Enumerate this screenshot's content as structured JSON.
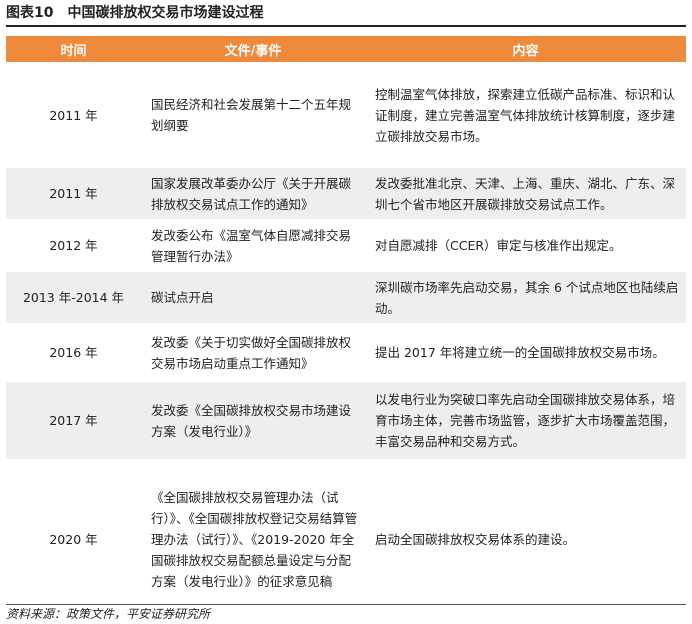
{
  "figure": {
    "number": "图表10",
    "title": "中国碳排放权交易市场建设过程"
  },
  "table": {
    "headers": [
      "时间",
      "文件/事件",
      "内容"
    ],
    "rows": [
      {
        "time": "2011 年",
        "doc": "国民经济和社会发展第十二个五年规划纲要",
        "content": "控制温室气体排放，探索建立低碳产品标准、标识和认证制度，建立完善温室气体排放统计核算制度，逐步建立碳排放交易市场。"
      },
      {
        "time": "2011 年",
        "doc": "国家发展改革委办公厅《关于开展碳排放权交易试点工作的通知》",
        "content": "发改委批准北京、天津、上海、重庆、湖北、广东、深圳七个省市地区开展碳排放交易试点工作。"
      },
      {
        "time": "2012 年",
        "doc": "发改委公布《温室气体自愿减排交易管理暂行办法》",
        "content": "对自愿减排（CCER）审定与核准作出规定。"
      },
      {
        "time": "2013 年-2014 年",
        "doc": "碳试点开启",
        "content": "深圳碳市场率先启动交易，其余 6 个试点地区也陆续启动。"
      },
      {
        "time": "2016 年",
        "doc": "发改委《关于切实做好全国碳排放权交易市场启动重点工作通知》",
        "content": "提出 2017 年将建立统一的全国碳排放权交易市场。"
      },
      {
        "time": "2017 年",
        "doc": "发改委《全国碳排放权交易市场建设方案（发电行业）》",
        "content": "以发电行业为突破口率先启动全国碳排放交易体系，培育市场主体，完善市场监管，逐步扩大市场覆盖范围，丰富交易品种和交易方式。"
      },
      {
        "time": "2020 年",
        "doc": "《全国碳排放权交易管理办法（试行）》、《全国碳排放权登记交易结算管理办法（试行）》、《2019-2020 年全国碳排放权交易配额总量设定与分配方案（发电行业）》的征求意见稿",
        "content": "启动全国碳排放权交易体系的建设。"
      }
    ]
  },
  "source": "资料来源：政策文件，平安证券研究所",
  "colors": {
    "header_bg": "#ef8a3c",
    "alt_row_bg": "#eeeeee"
  }
}
